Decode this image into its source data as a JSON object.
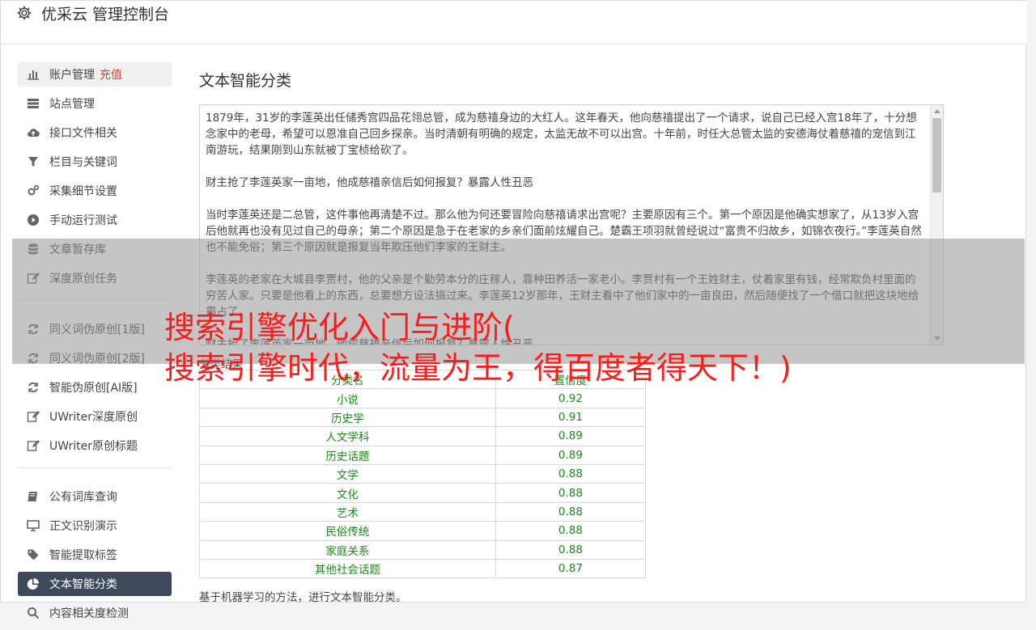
{
  "app": {
    "title": "优采云 管理控制台",
    "icon": "gear-icon"
  },
  "sidebar": {
    "groups": [
      [
        {
          "label": "账户管理",
          "badge": "充值",
          "icon": "bar-chart-icon"
        },
        {
          "label": "站点管理",
          "icon": "server-icon"
        },
        {
          "label": "接口文件相关",
          "icon": "cloud-upload-icon"
        },
        {
          "label": "栏目与关键词",
          "icon": "filter-icon"
        },
        {
          "label": "采集细节设置",
          "icon": "gears-icon"
        },
        {
          "label": "手动运行测试",
          "icon": "play-circle-icon"
        },
        {
          "label": "文章暂存库",
          "icon": "database-icon"
        },
        {
          "label": "深度原创任务",
          "icon": "edit-icon"
        }
      ],
      [
        {
          "label": "同义词伪原创[1版]",
          "icon": "refresh-icon"
        },
        {
          "label": "同义词伪原创[2版]",
          "icon": "refresh-icon"
        },
        {
          "label": "智能伪原创[AI版]",
          "icon": "refresh-icon"
        },
        {
          "label": "UWriter深度原创",
          "icon": "edit-icon"
        },
        {
          "label": "UWriter原创标题",
          "icon": "edit-icon"
        }
      ],
      [
        {
          "label": "公有词库查询",
          "icon": "book-icon"
        },
        {
          "label": "正文识别演示",
          "icon": "monitor-icon"
        },
        {
          "label": "智能提取标签",
          "icon": "tag-icon"
        },
        {
          "label": "文本智能分类",
          "icon": "pie-chart-icon",
          "active": true
        },
        {
          "label": "内容相关度检测",
          "icon": "search-icon"
        }
      ]
    ]
  },
  "main": {
    "title": "文本智能分类",
    "text_paragraphs": [
      "1879年，31岁的李莲英出任储秀宫四品花翎总管，成为慈禧身边的大红人。这年春天，他向慈禧提出了一个请求，说自己已经入宫18年了，十分想念家中的老母，希望可以恩准自己回乡探亲。当时清朝有明确的规定，太监无故不可以出宫。十年前，时任大总管太监的安德海仗着慈禧的宠信到江南游玩，结果刚到山东就被丁宝桢给砍了。",
      "财主抢了李莲英家一亩地，他成慈禧亲信后如何报复？暴露人性丑恶",
      "当时李莲英还是二总管，这件事他再清楚不过。那么他为何还要冒险向慈禧请求出宫呢？主要原因有三个。第一个原因是他确实想家了，从13岁入宫后他就再也没有见过自己的母亲；第二个原因是急于在老家的乡亲们面前炫耀自己。楚霸王项羽就曾经说过“富贵不归故乡，如锦衣夜行。”李莲英自然也不能免俗；第三个原因就是报复当年欺压他们李家的王财主。",
      "李莲英的老家在大城县李贾村，他的父亲是个勤劳本分的庄稼人，靠种田养活一家老小。李贾村有一个王姓财主，仗着家里有钱，经常欺负村里面的穷苦人家。只要是他看上的东西，总要想方设法搞过来。李莲英12岁那年，王财主看中了他们家中的一亩良田，然后随便找了一个借口就把这块地给霸占了。",
      "财主抢了李莲英家一亩地，他成慈禧亲信后如何报复？暴露人性丑恶"
    ],
    "result_label": "分类结果",
    "table": {
      "headers": [
        "分类名",
        "置信度"
      ],
      "rows": [
        [
          "小说",
          "0.92"
        ],
        [
          "历史学",
          "0.91"
        ],
        [
          "人文学科",
          "0.89"
        ],
        [
          "历史话题",
          "0.89"
        ],
        [
          "文学",
          "0.88"
        ],
        [
          "文化",
          "0.88"
        ],
        [
          "艺术",
          "0.88"
        ],
        [
          "民俗传统",
          "0.88"
        ],
        [
          "家庭关系",
          "0.88"
        ],
        [
          "其他社会话题",
          "0.87"
        ]
      ]
    },
    "description": "基于机器学习的方法，进行文本智能分类。"
  },
  "overlay": {
    "line1": "搜索引擎优化入门与进阶(",
    "line2": "搜索引擎时代，流量为王，得百度者得天下！)"
  }
}
